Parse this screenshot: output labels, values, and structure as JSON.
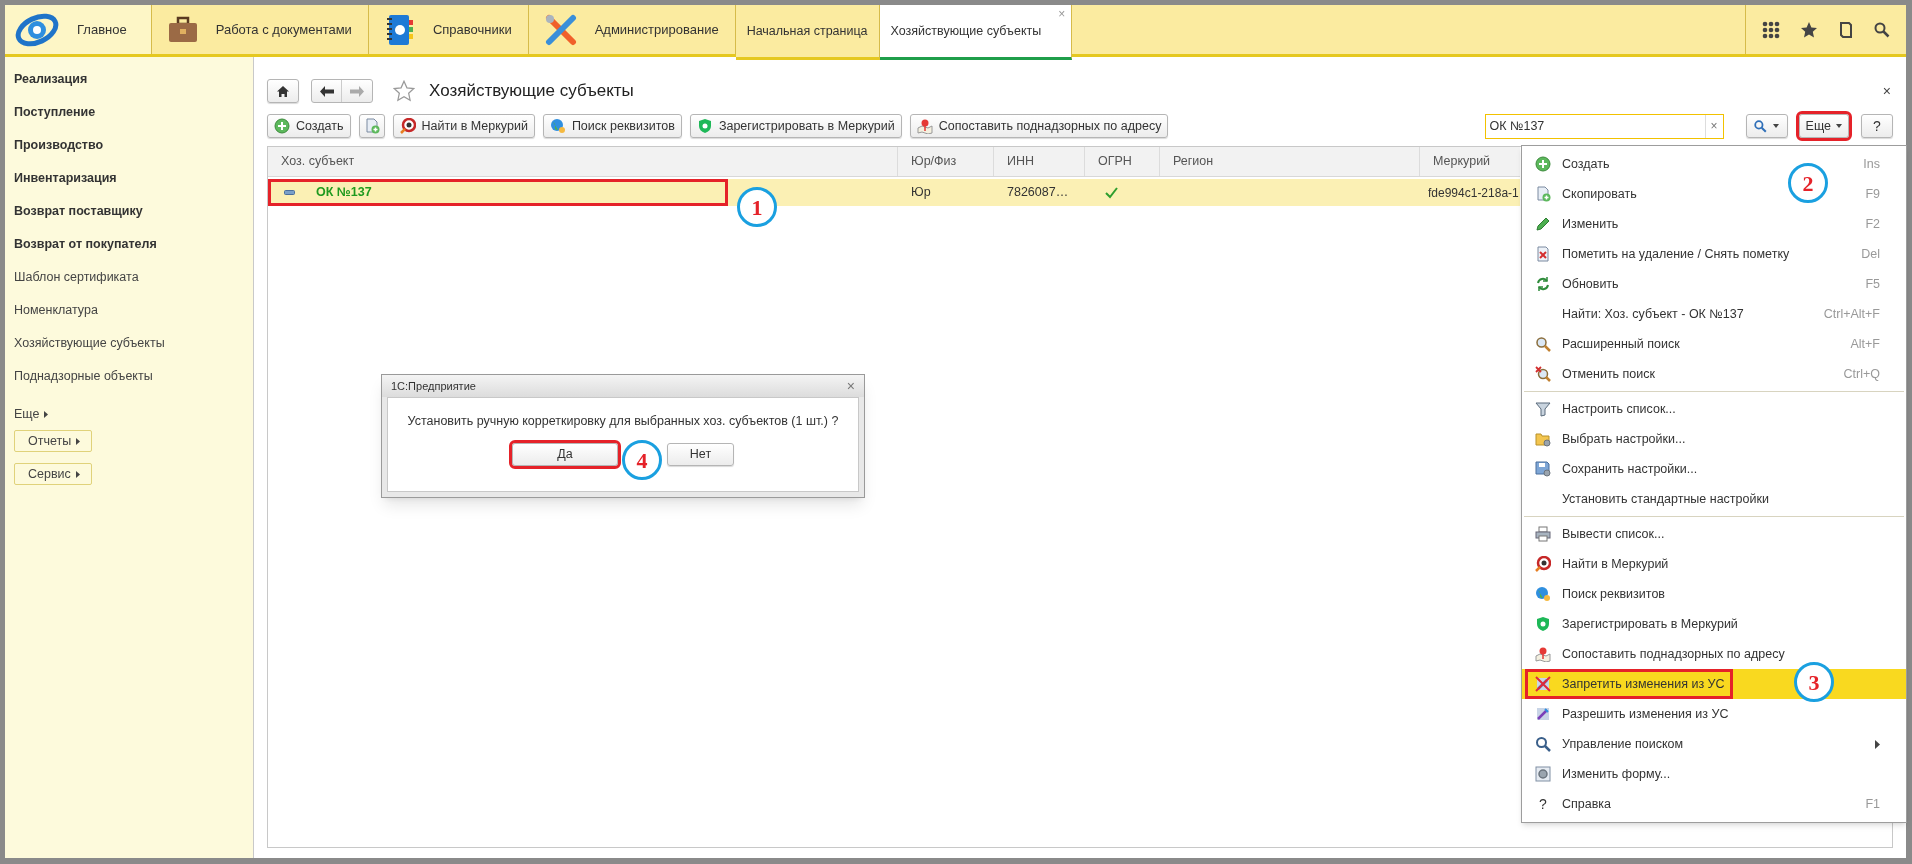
{
  "top_sections": [
    {
      "label": "Главное",
      "kind": "logo",
      "selected": true
    },
    {
      "label": "Работа с документами",
      "kind": "briefcase",
      "selected": false
    },
    {
      "label": "Справочники",
      "kind": "book",
      "selected": false
    },
    {
      "label": "Администрирование",
      "kind": "tools",
      "selected": false
    }
  ],
  "open_tabs": [
    {
      "label": "Начальная страница",
      "selected": false
    },
    {
      "label": "Хозяйствующие субъекты",
      "selected": true,
      "close": "×"
    }
  ],
  "sidebar": {
    "items": [
      {
        "label": "Реализация",
        "kind": "section"
      },
      {
        "label": "Поступление",
        "kind": "section"
      },
      {
        "label": "Производство",
        "kind": "section"
      },
      {
        "label": "Инвентаризация",
        "kind": "section"
      },
      {
        "label": "Возврат поставщику",
        "kind": "section"
      },
      {
        "label": "Возврат от покупателя",
        "kind": "section"
      },
      {
        "label": "Шаблон сертификата",
        "kind": "link"
      },
      {
        "label": "Номенклатура",
        "kind": "link"
      },
      {
        "label": "Хозяйствующие субъекты",
        "kind": "link"
      },
      {
        "label": "Поднадзорные объекты",
        "kind": "link"
      },
      {
        "label": "Еще",
        "kind": "more"
      },
      {
        "label": "Отчеты",
        "kind": "button"
      },
      {
        "label": "Сервис",
        "kind": "button"
      }
    ]
  },
  "form": {
    "title": "Хозяйствующие субъекты",
    "close": "×",
    "toolbar": [
      {
        "label": "Создать",
        "kind": "create"
      },
      {
        "kind": "copy"
      },
      {
        "label": "Найти в Меркурий",
        "kind": "mercury"
      },
      {
        "label": "Поиск реквизитов",
        "kind": "globe"
      },
      {
        "label": "Зарегистрировать в Меркурий",
        "kind": "shield"
      },
      {
        "label": "Сопоставить поднадзорных по адресу",
        "kind": "pin"
      }
    ],
    "search": {
      "value": "ОК №137",
      "clear": "×"
    },
    "more_button": {
      "label": "Еще",
      "outlined": true
    },
    "help_button": {
      "label": "?"
    }
  },
  "table": {
    "columns": [
      "Хоз. субъект",
      "Юр/Физ",
      "ИНН",
      "ОГРН",
      "Регион",
      "Меркурий"
    ],
    "rows": [
      {
        "name": "ОК №137",
        "type": "Юр",
        "inn": "7826087…",
        "ogrn_checked": true,
        "mercury": "fde994c1-218a-1",
        "selected": true,
        "outlined": true
      }
    ]
  },
  "menu": {
    "groups": [
      [
        {
          "label": "Создать",
          "shortcut": "Ins",
          "kind": "create"
        },
        {
          "label": "Скопировать",
          "shortcut": "F9",
          "kind": "copy"
        },
        {
          "label": "Изменить",
          "shortcut": "F2",
          "kind": "pencil"
        },
        {
          "label": "Пометить на удаление / Снять пометку",
          "shortcut": "Del",
          "kind": "delete"
        },
        {
          "label": "Обновить",
          "shortcut": "F5",
          "kind": "refresh"
        },
        {
          "label": "Найти: Хоз. субъект - ОК №137",
          "shortcut": "Ctrl+Alt+F",
          "kind": "plain"
        },
        {
          "label": "Расширенный поиск",
          "shortcut": "Alt+F",
          "kind": "magnifier"
        },
        {
          "label": "Отменить поиск",
          "shortcut": "Ctrl+Q",
          "kind": "cancel"
        }
      ],
      [
        {
          "label": "Настроить список...",
          "kind": "funnel"
        },
        {
          "label": "Выбрать настройки...",
          "kind": "folder"
        },
        {
          "label": "Сохранить настройки...",
          "kind": "disk"
        },
        {
          "label": "Установить стандартные настройки",
          "kind": "plain"
        }
      ],
      [
        {
          "label": "Вывести список...",
          "kind": "printer"
        },
        {
          "label": "Найти в Меркурий",
          "kind": "mercury"
        },
        {
          "label": "Поиск реквизитов",
          "kind": "globe"
        },
        {
          "label": "Зарегистрировать в Меркурий",
          "kind": "shield"
        },
        {
          "label": "Сопоставить поднадзорных по адресу",
          "kind": "pin"
        },
        {
          "label": "Запретить изменения из УС",
          "kind": "forbid",
          "highlighted": true,
          "outlined": true
        },
        {
          "label": "Разрешить изменения из УС",
          "kind": "allow"
        },
        {
          "label": "Управление поиском",
          "kind": "search",
          "submenu": true
        },
        {
          "label": "Изменить форму...",
          "kind": "form"
        },
        {
          "label": "Справка",
          "shortcut": "F1",
          "kind": "char",
          "icon_char": "?"
        }
      ]
    ]
  },
  "dialog": {
    "title": "1С:Предприятие",
    "close": "×",
    "message": "Установить ручную корреткировку для выбранных хоз. субъектов (1 шт.) ?",
    "buttons": [
      {
        "label": "Да",
        "outlined": true
      },
      {
        "label": "Нет",
        "outlined": false
      }
    ]
  },
  "callouts": [
    "1",
    "2",
    "3",
    "4"
  ]
}
